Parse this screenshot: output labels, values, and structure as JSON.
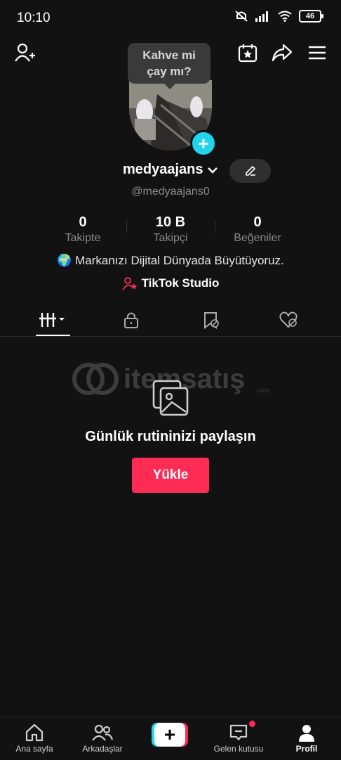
{
  "status": {
    "time": "10:10",
    "battery": "46"
  },
  "tooltip": {
    "line1": "Kahve mi",
    "line2": "çay mı?"
  },
  "profile": {
    "username": "medyaajans",
    "handle": "@medyaajans0",
    "bio": "🌍 Markanızı Dijital Dünyada Büyütüyoruz.",
    "studio_link": "TikTok Studio"
  },
  "stats": [
    {
      "value": "0",
      "label": "Takipte"
    },
    {
      "value": "10 B",
      "label": "Takipçi"
    },
    {
      "value": "0",
      "label": "Beğeniler"
    }
  ],
  "tabs": [
    "videos-grid-icon",
    "lock-icon",
    "hidden-reposts-icon",
    "hidden-likes-icon"
  ],
  "empty_state": {
    "title": "Günlük rutininizi paylaşın",
    "button": "Yükle"
  },
  "watermark": {
    "text": "itemsatış",
    "suffix": ".com"
  },
  "bottom_nav": {
    "home": "Ana sayfa",
    "friends": "Arkadaşlar",
    "inbox": "Gelen kutusu",
    "profile": "Profil"
  },
  "colors": {
    "accent": "#fe2c55",
    "cyan": "#20d5ec",
    "background": "#121212"
  }
}
